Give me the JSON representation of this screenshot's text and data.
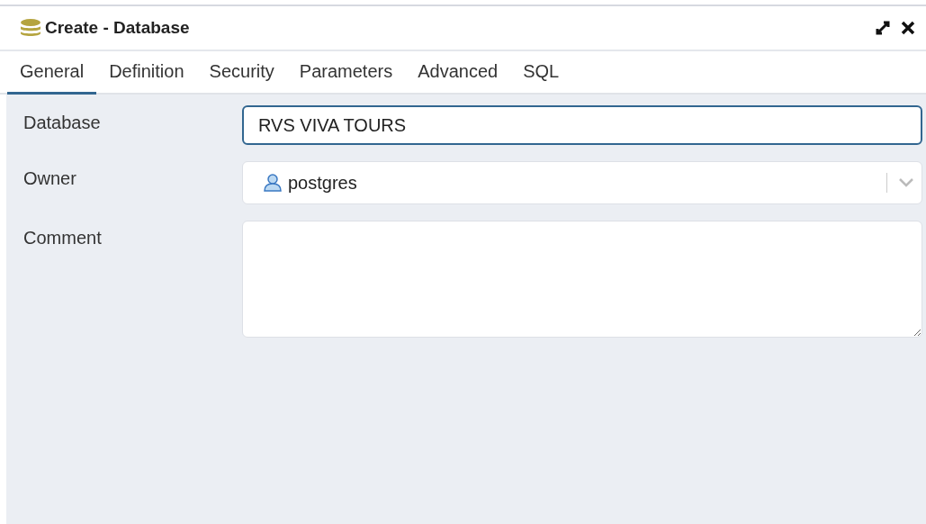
{
  "window": {
    "title": "Create - Database"
  },
  "tabs": [
    {
      "label": "General",
      "selected": true
    },
    {
      "label": "Definition",
      "selected": false
    },
    {
      "label": "Security",
      "selected": false
    },
    {
      "label": "Parameters",
      "selected": false
    },
    {
      "label": "Advanced",
      "selected": false
    },
    {
      "label": "SQL",
      "selected": false
    }
  ],
  "fields": [
    {
      "kind": "text",
      "label": "Database",
      "value": "RVS VIVA TOURS",
      "focused": true
    },
    {
      "kind": "select",
      "label": "Owner",
      "value": "postgres"
    },
    {
      "kind": "textarea",
      "label": "Comment"
    }
  ]
}
